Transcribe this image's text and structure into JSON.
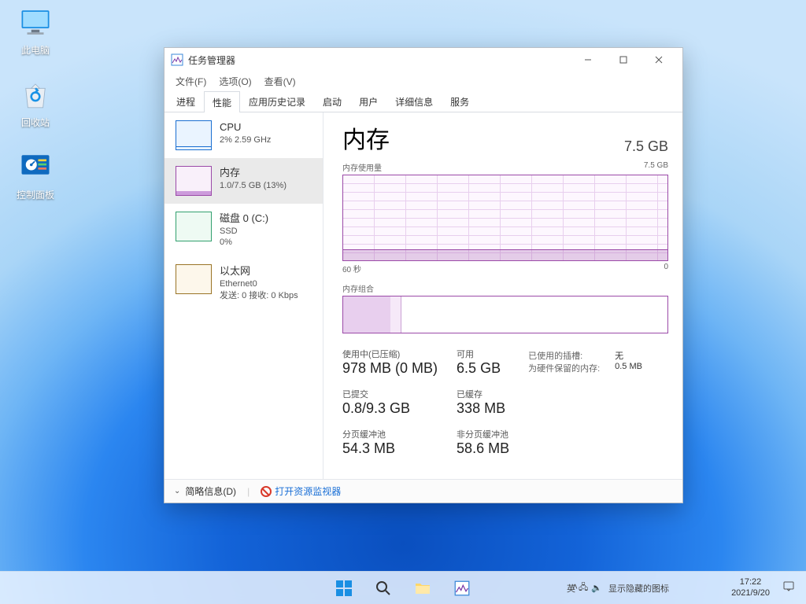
{
  "desktop_icons": {
    "this_pc": "此电脑",
    "recycle": "回收站",
    "control_panel": "控制面板"
  },
  "taskbar": {
    "tray_hint": "显示隐藏的图标",
    "time": "17:22",
    "date": "2021/9/20"
  },
  "window": {
    "title": "任务管理器"
  },
  "menus": {
    "file": "文件(F)",
    "options": "选项(O)",
    "view": "查看(V)"
  },
  "tabs": {
    "procs": "进程",
    "perf": "性能",
    "apphist": "应用历史记录",
    "startup": "启动",
    "users": "用户",
    "details": "详细信息",
    "services": "服务"
  },
  "perf_list": {
    "cpu": {
      "title": "CPU",
      "detail": "2% 2.59 GHz"
    },
    "mem": {
      "title": "内存",
      "detail": "1.0/7.5 GB (13%)"
    },
    "disk": {
      "title": "磁盘 0 (C:)",
      "sub1": "SSD",
      "sub2": "0%"
    },
    "eth": {
      "title": "以太网",
      "sub1": "Ethernet0",
      "sub2": "发送: 0 接收: 0 Kbps"
    }
  },
  "detail": {
    "header_title": "内存",
    "header_cap": "7.5 GB",
    "usage_label": "内存使用量",
    "usage_cap": "7.5 GB",
    "axis_left": "60 秒",
    "axis_right": "0",
    "comp_label": "内存组合",
    "stats": {
      "in_use_lbl": "使用中(已压缩)",
      "in_use_val": "978 MB (0 MB)",
      "avail_lbl": "可用",
      "avail_val": "6.5 GB",
      "commit_lbl": "已提交",
      "commit_val": "0.8/9.3 GB",
      "cached_lbl": "已缓存",
      "cached_val": "338 MB",
      "page_lbl": "分页缓冲池",
      "page_val": "54.3 MB",
      "nonpage_lbl": "非分页缓冲池",
      "nonpage_val": "58.6 MB"
    },
    "right": {
      "slots_k": "已使用的插槽:",
      "slots_v": "无",
      "hw_k": "为硬件保留的内存:",
      "hw_v": "0.5 MB"
    }
  },
  "footer": {
    "fewer": "简略信息(D)",
    "resmon": "打开资源监视器"
  },
  "chart_data": {
    "type": "line",
    "title": "内存使用量",
    "xlabel": "60 秒 → 0",
    "ylabel": "GB",
    "ylim": [
      0,
      7.5
    ],
    "x_seconds_ago": [
      60,
      55,
      50,
      45,
      40,
      35,
      30,
      25,
      20,
      15,
      10,
      5,
      0
    ],
    "values_gb": [
      1.0,
      1.0,
      1.0,
      1.0,
      1.0,
      1.0,
      1.0,
      1.0,
      1.0,
      1.0,
      1.0,
      1.0,
      1.0
    ],
    "memory_composition_gb": {
      "in_use": 0.98,
      "modified": 0.2,
      "standby": 0.33,
      "free": 6.0,
      "total": 7.5
    }
  }
}
